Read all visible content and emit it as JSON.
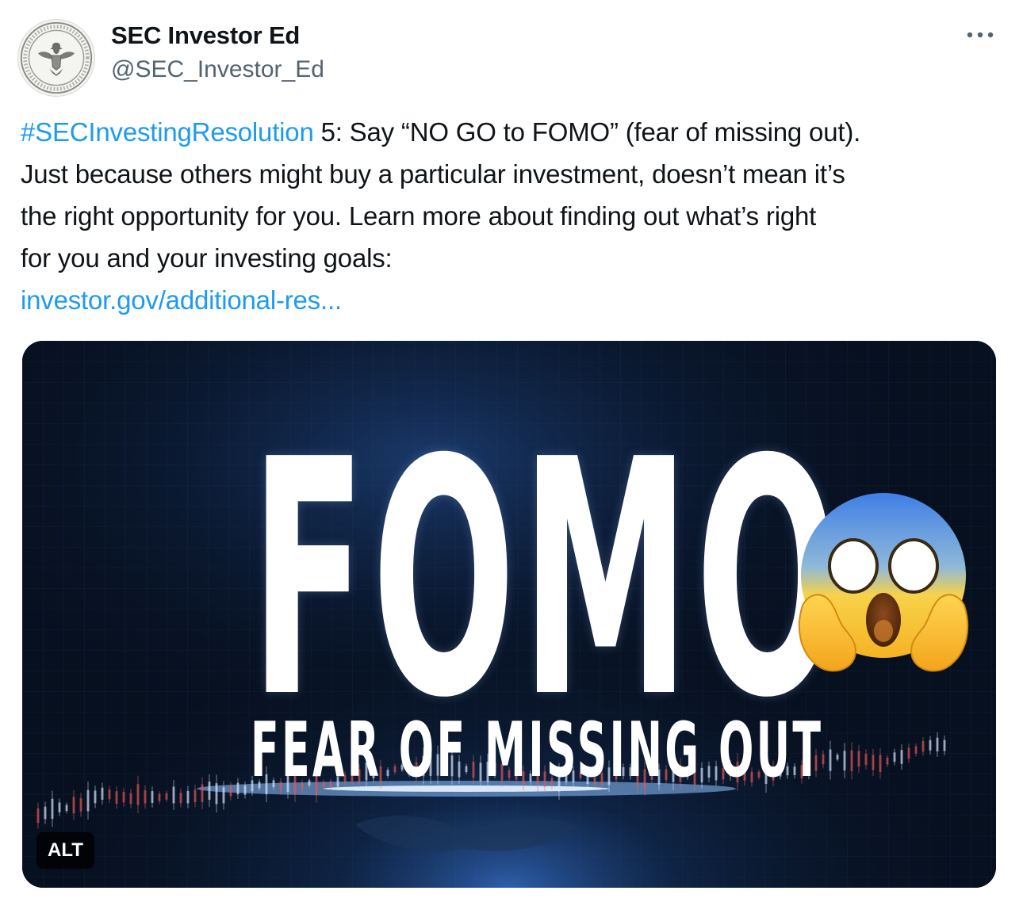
{
  "author": {
    "display_name": "SEC Investor Ed",
    "handle": "@SEC_Investor_Ed",
    "avatar_icon": "sec-seal-icon"
  },
  "more_icon": "more-horizontal-icon",
  "tweet": {
    "hashtag": "#SECInvestingResolution",
    "line1_rest": " 5: Say “NO GO to FOMO” (fear of missing out).",
    "line2": "Just because others might buy a particular investment, doesn’t mean it’s",
    "line3": "the right opportunity for you. Learn more about finding out what’s right",
    "line4": "for you and your investing goals:",
    "link": "investor.gov/additional-res..."
  },
  "media": {
    "title": "FOMO",
    "subtitle": "FEAR OF MISSING OUT",
    "emoji": "face-screaming-in-fear-icon",
    "alt_label": "ALT"
  },
  "colors": {
    "link": "#1d9bf0",
    "text": "#0f1419",
    "secondary_text": "#536471",
    "media_background": "#07101f"
  }
}
